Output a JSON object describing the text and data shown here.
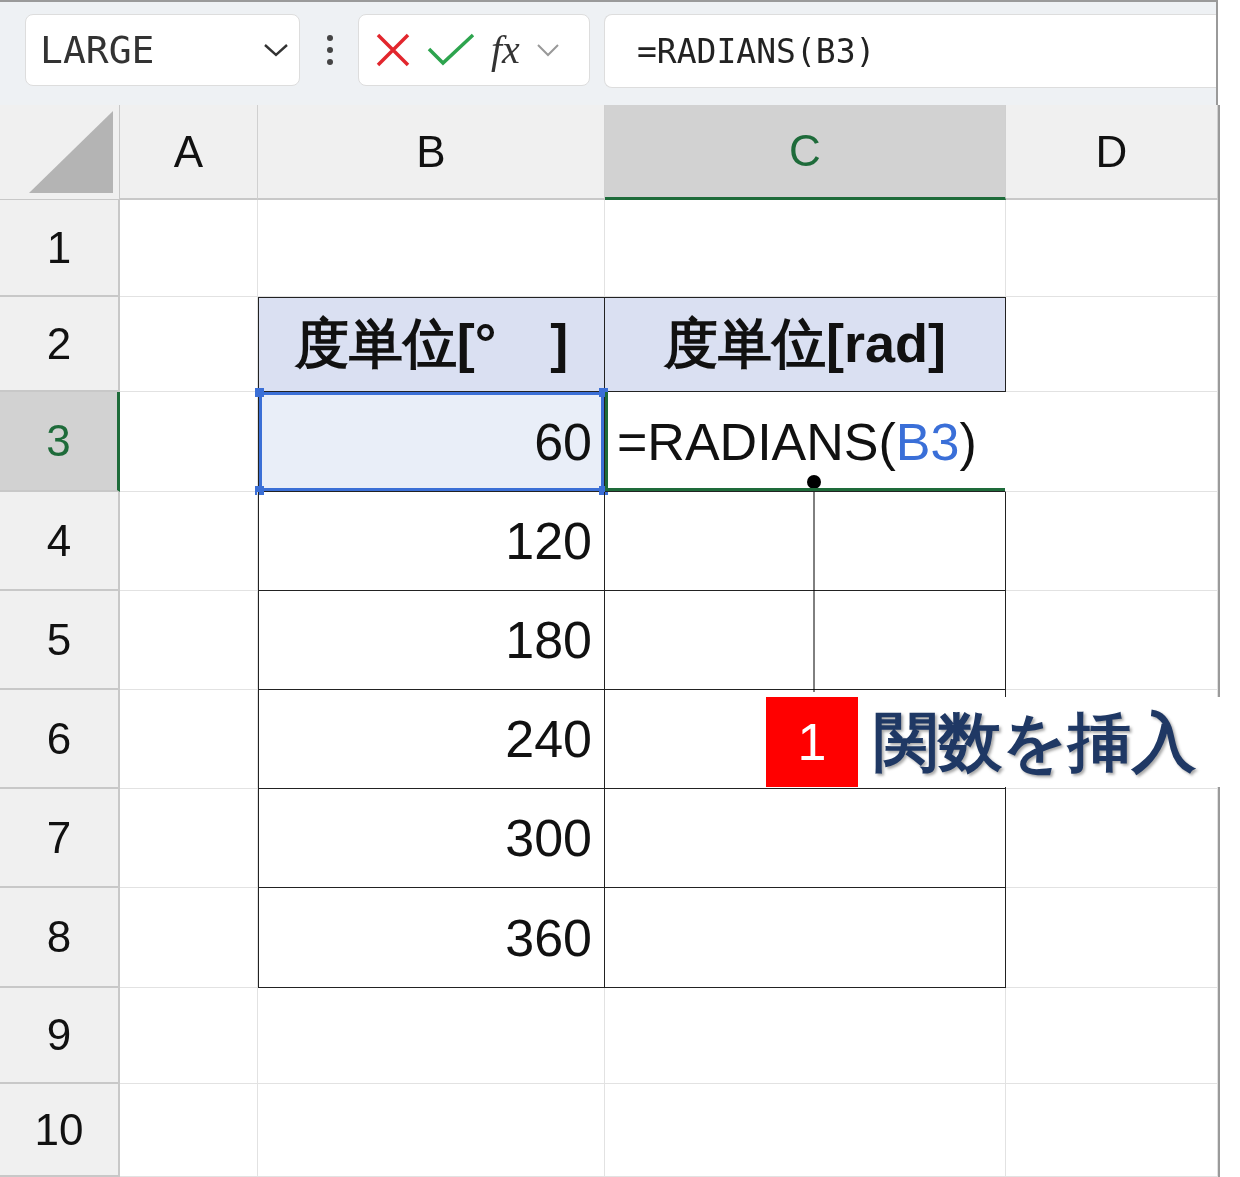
{
  "name_box": {
    "value": "LARGE"
  },
  "function_button": {
    "label": "fx"
  },
  "formula_bar": {
    "value": "=RADIANS(B3)"
  },
  "columns": [
    {
      "label": "A",
      "selected": false
    },
    {
      "label": "B",
      "selected": false
    },
    {
      "label": "C",
      "selected": true
    },
    {
      "label": "D",
      "selected": false
    }
  ],
  "rows": [
    {
      "label": "1",
      "selected": false,
      "kind": "empty"
    },
    {
      "label": "2",
      "selected": false,
      "kind": "header",
      "b": "度単位[°　]",
      "c": [
        {
          "text": "度単位[rad]",
          "kind": "plain"
        }
      ]
    },
    {
      "label": "3",
      "selected": true,
      "kind": "data",
      "b": "60",
      "b_highlighted": true,
      "c": [
        {
          "text": "=RADIANS(",
          "kind": "plain"
        },
        {
          "text": "B3",
          "kind": "reference"
        },
        {
          "text": ")",
          "kind": "plain"
        }
      ]
    },
    {
      "label": "4",
      "selected": false,
      "kind": "data",
      "b": "120"
    },
    {
      "label": "5",
      "selected": false,
      "kind": "data",
      "b": "180"
    },
    {
      "label": "6",
      "selected": false,
      "kind": "data",
      "b": "240"
    },
    {
      "label": "7",
      "selected": false,
      "kind": "data",
      "b": "300"
    },
    {
      "label": "8",
      "selected": false,
      "kind": "data",
      "b": "360"
    },
    {
      "label": "9",
      "selected": false,
      "kind": "empty"
    },
    {
      "label": "10",
      "selected": false,
      "kind": "empty"
    }
  ],
  "callout": {
    "number": "1",
    "text": "関数を挿入"
  }
}
